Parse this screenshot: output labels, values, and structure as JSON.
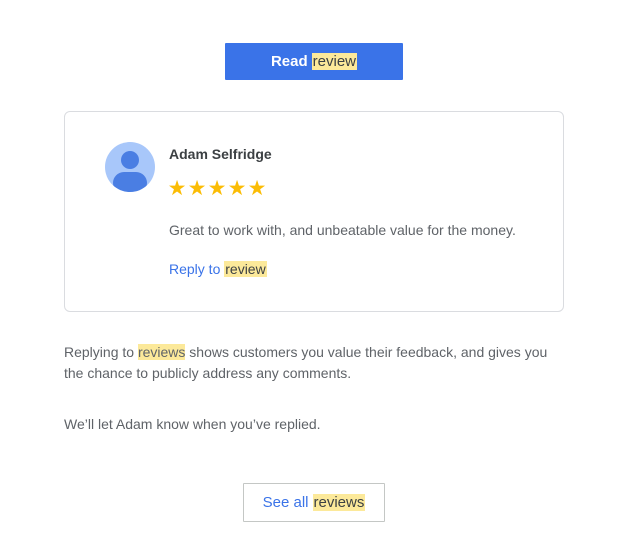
{
  "read_button": {
    "label_prefix": "Read",
    "label_highlight": "review"
  },
  "review_card": {
    "reviewer_name": "Adam Selfridge",
    "rating": 5,
    "rating_max": 5,
    "star_glyph": "★",
    "review_text": "Great to work with, and unbeatable value for the money.",
    "reply_link": {
      "prefix": "Reply to",
      "highlight": "review"
    },
    "avatar_icon": "person-icon"
  },
  "info": {
    "para1_prefix": "Replying to",
    "para1_highlight": "reviews",
    "para1_suffix": "shows customers you value their feedback, and gives you the chance to publicly address any comments.",
    "para2": "We’ll let Adam know when you’ve replied."
  },
  "see_all_button": {
    "label_prefix": "See all",
    "label_highlight": "reviews"
  },
  "colors": {
    "primary_button": "#3a73e8",
    "highlight": "#fce99a",
    "star": "#fbbc04",
    "avatar_bg": "#a8c7fa",
    "avatar_fg": "#4a7ee3"
  }
}
